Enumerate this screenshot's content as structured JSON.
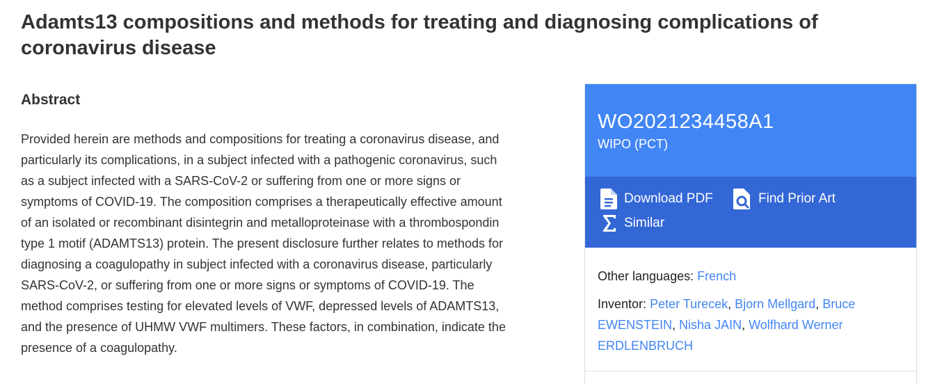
{
  "document": {
    "title": "Adamts13 compositions and methods for treating and diagnosing complications of coronavirus disease"
  },
  "abstract": {
    "heading": "Abstract",
    "text": "Provided herein are methods and compositions for treating a coronavirus disease, and particularly its complications, in a subject infected with a pathogenic coronavirus, such as a subject infected with a SARS-CoV-2 or suffering from one or more signs or symptoms of COVID-19. The composition comprises a therapeutically effective amount of an isolated or recombinant disintegrin and metalloproteinase with a thrombospondin type 1 motif (ADAMTS13) protein. The present disclosure further relates to methods for diagnosing a coagulopathy in subject infected with a coronavirus disease, particularly SARS-CoV-2, or suffering from one or more signs or symptoms of COVID-19. The method comprises testing for elevated levels of VWF, depressed levels of ADAMTS13, and the presence of UHMW VWF multimers. These factors, in combination, indicate the presence of a coagulopathy."
  },
  "card": {
    "publication_number": "WO2021234458A1",
    "office": "WIPO (PCT)",
    "actions": {
      "download_pdf": "Download PDF",
      "find_prior_art": "Find Prior Art",
      "similar": "Similar"
    },
    "other_languages_label": "Other languages:",
    "other_languages": [
      "French"
    ],
    "inventor_label": "Inventor:",
    "inventors": [
      "Peter Turecek",
      "Bjorn Mellgard",
      "Bruce EWENSTEIN",
      "Nisha JAIN",
      "Wolfhard Werner ERDLENBRUCH"
    ],
    "separator": ", "
  },
  "colors": {
    "header_blue": "#4285f4",
    "actions_blue": "#3367d6",
    "link_blue": "#4285f4",
    "text": "#333333"
  },
  "icons": {
    "download_pdf": "document-icon",
    "find_prior_art": "search-document-icon",
    "similar": "sigma-icon"
  }
}
